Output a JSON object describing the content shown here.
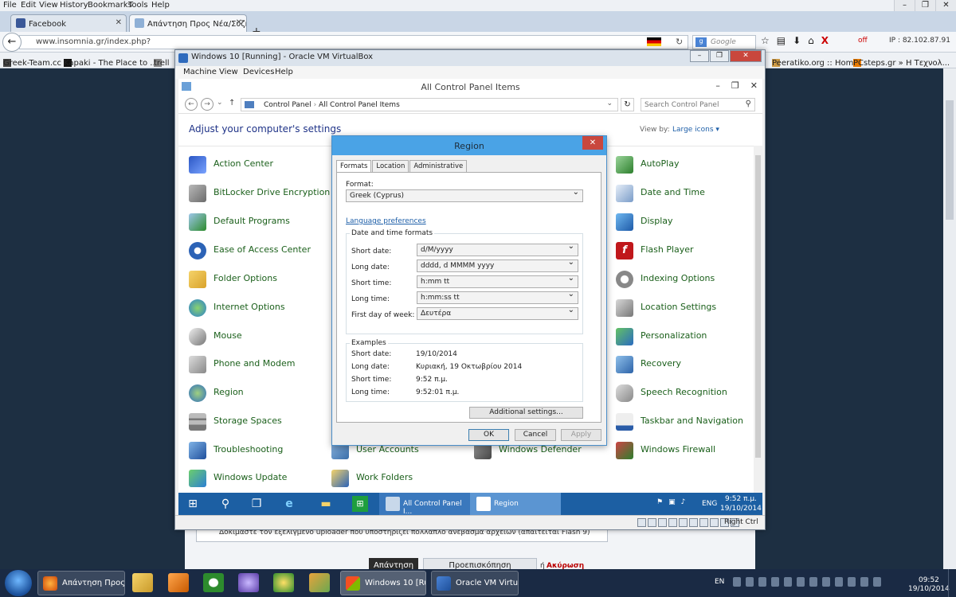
{
  "firefox": {
    "menu": [
      "File",
      "Edit",
      "View",
      "History",
      "Bookmarks",
      "Tools",
      "Help"
    ],
    "tabs": [
      {
        "label": "Facebook"
      },
      {
        "label": "Απάντηση Προς Νέα/Συζή..."
      }
    ],
    "url": "www.insomnia.gr/index.php?",
    "search_placeholder": "Google",
    "addon_off": "off",
    "ip": "IP : 82.102.87.91",
    "bookmarks": [
      "Greek-Team.cc",
      "Kapaki - The Place to ...",
      "trell",
      "Peeratiko.org :: Home",
      "PCsteps.gr » Η Τεχνολ..."
    ]
  },
  "background_page": {
    "hint": "Δοκιμάστε τον εξελιγμένο uploader που υποστηρίζει πολλαπλό ανέβασμα αρχείων (απαιτείται Flash 9)",
    "reply": "Απάντηση",
    "preview": "Προεπισκόπηση Δημοσίευσης",
    "or": "ή",
    "cancel": "Ακύρωση"
  },
  "vbox": {
    "title": "Windows 10 [Running] - Oracle VM VirtualBox",
    "menu": [
      "Machine",
      "View",
      "Devices",
      "Help"
    ],
    "host_key": "Right Ctrl"
  },
  "control_panel": {
    "title": "All Control Panel Items",
    "breadcrumb": [
      "Control Panel",
      "All Control Panel Items"
    ],
    "search_placeholder": "Search Control Panel",
    "heading": "Adjust your computer's settings",
    "view_by_label": "View by:",
    "view_by_value": "Large icons",
    "items_left": [
      "Action Center",
      "BitLocker Drive Encryption",
      "Default Programs",
      "Ease of Access Center",
      "Folder Options",
      "Internet Options",
      "Mouse",
      "Phone and Modem",
      "Region",
      "Storage Spaces",
      "Troubleshooting",
      "Windows Update"
    ],
    "items_mid": [
      "User Accounts",
      "Work Folders"
    ],
    "items_mid2": [
      "Windows Defender"
    ],
    "items_right": [
      "AutoPlay",
      "Date and Time",
      "Display",
      "Flash Player",
      "Indexing Options",
      "Location Settings",
      "Personalization",
      "Recovery",
      "Speech Recognition",
      "Taskbar and Navigation",
      "Windows Firewall"
    ]
  },
  "region_dialog": {
    "title": "Region",
    "tabs": [
      "Formats",
      "Location",
      "Administrative"
    ],
    "format_label": "Format:",
    "format_value": "Greek (Cyprus)",
    "language_link": "Language preferences",
    "datetime_group": "Date and time formats",
    "fields": [
      {
        "label": "Short date:",
        "value": "d/M/yyyy"
      },
      {
        "label": "Long date:",
        "value": "dddd, d MMMM yyyy"
      },
      {
        "label": "Short time:",
        "value": "h:mm tt"
      },
      {
        "label": "Long time:",
        "value": "h:mm:ss tt"
      },
      {
        "label": "First day of week:",
        "value": "Δευτέρα"
      }
    ],
    "examples_group": "Examples",
    "examples": [
      {
        "label": "Short date:",
        "value": "19/10/2014"
      },
      {
        "label": "Long date:",
        "value": "Κυριακή, 19 Οκτωβρίου 2014"
      },
      {
        "label": "Short time:",
        "value": "9:52 π.μ."
      },
      {
        "label": "Long time:",
        "value": "9:52:01 π.μ."
      }
    ],
    "additional": "Additional settings...",
    "ok": "OK",
    "cancel": "Cancel",
    "apply": "Apply"
  },
  "guest_taskbar": {
    "buttons": [
      "All Control Panel I...",
      "Region"
    ],
    "lang": "ENG",
    "time": "9:52 π.μ.",
    "date": "19/10/2014"
  },
  "host_taskbar": {
    "buttons": [
      "Απάντηση Προς ...",
      "Windows 10 [Run...",
      "Oracle VM Virtual..."
    ],
    "lang": "EN",
    "time": "09:52",
    "date": "19/10/2014"
  },
  "colors": {
    "cp_link_green": "#1a5f1a",
    "w10_taskbar": "#1c5fa3",
    "dialog_title": "#4aa3e6",
    "close_red": "#c9473d"
  }
}
